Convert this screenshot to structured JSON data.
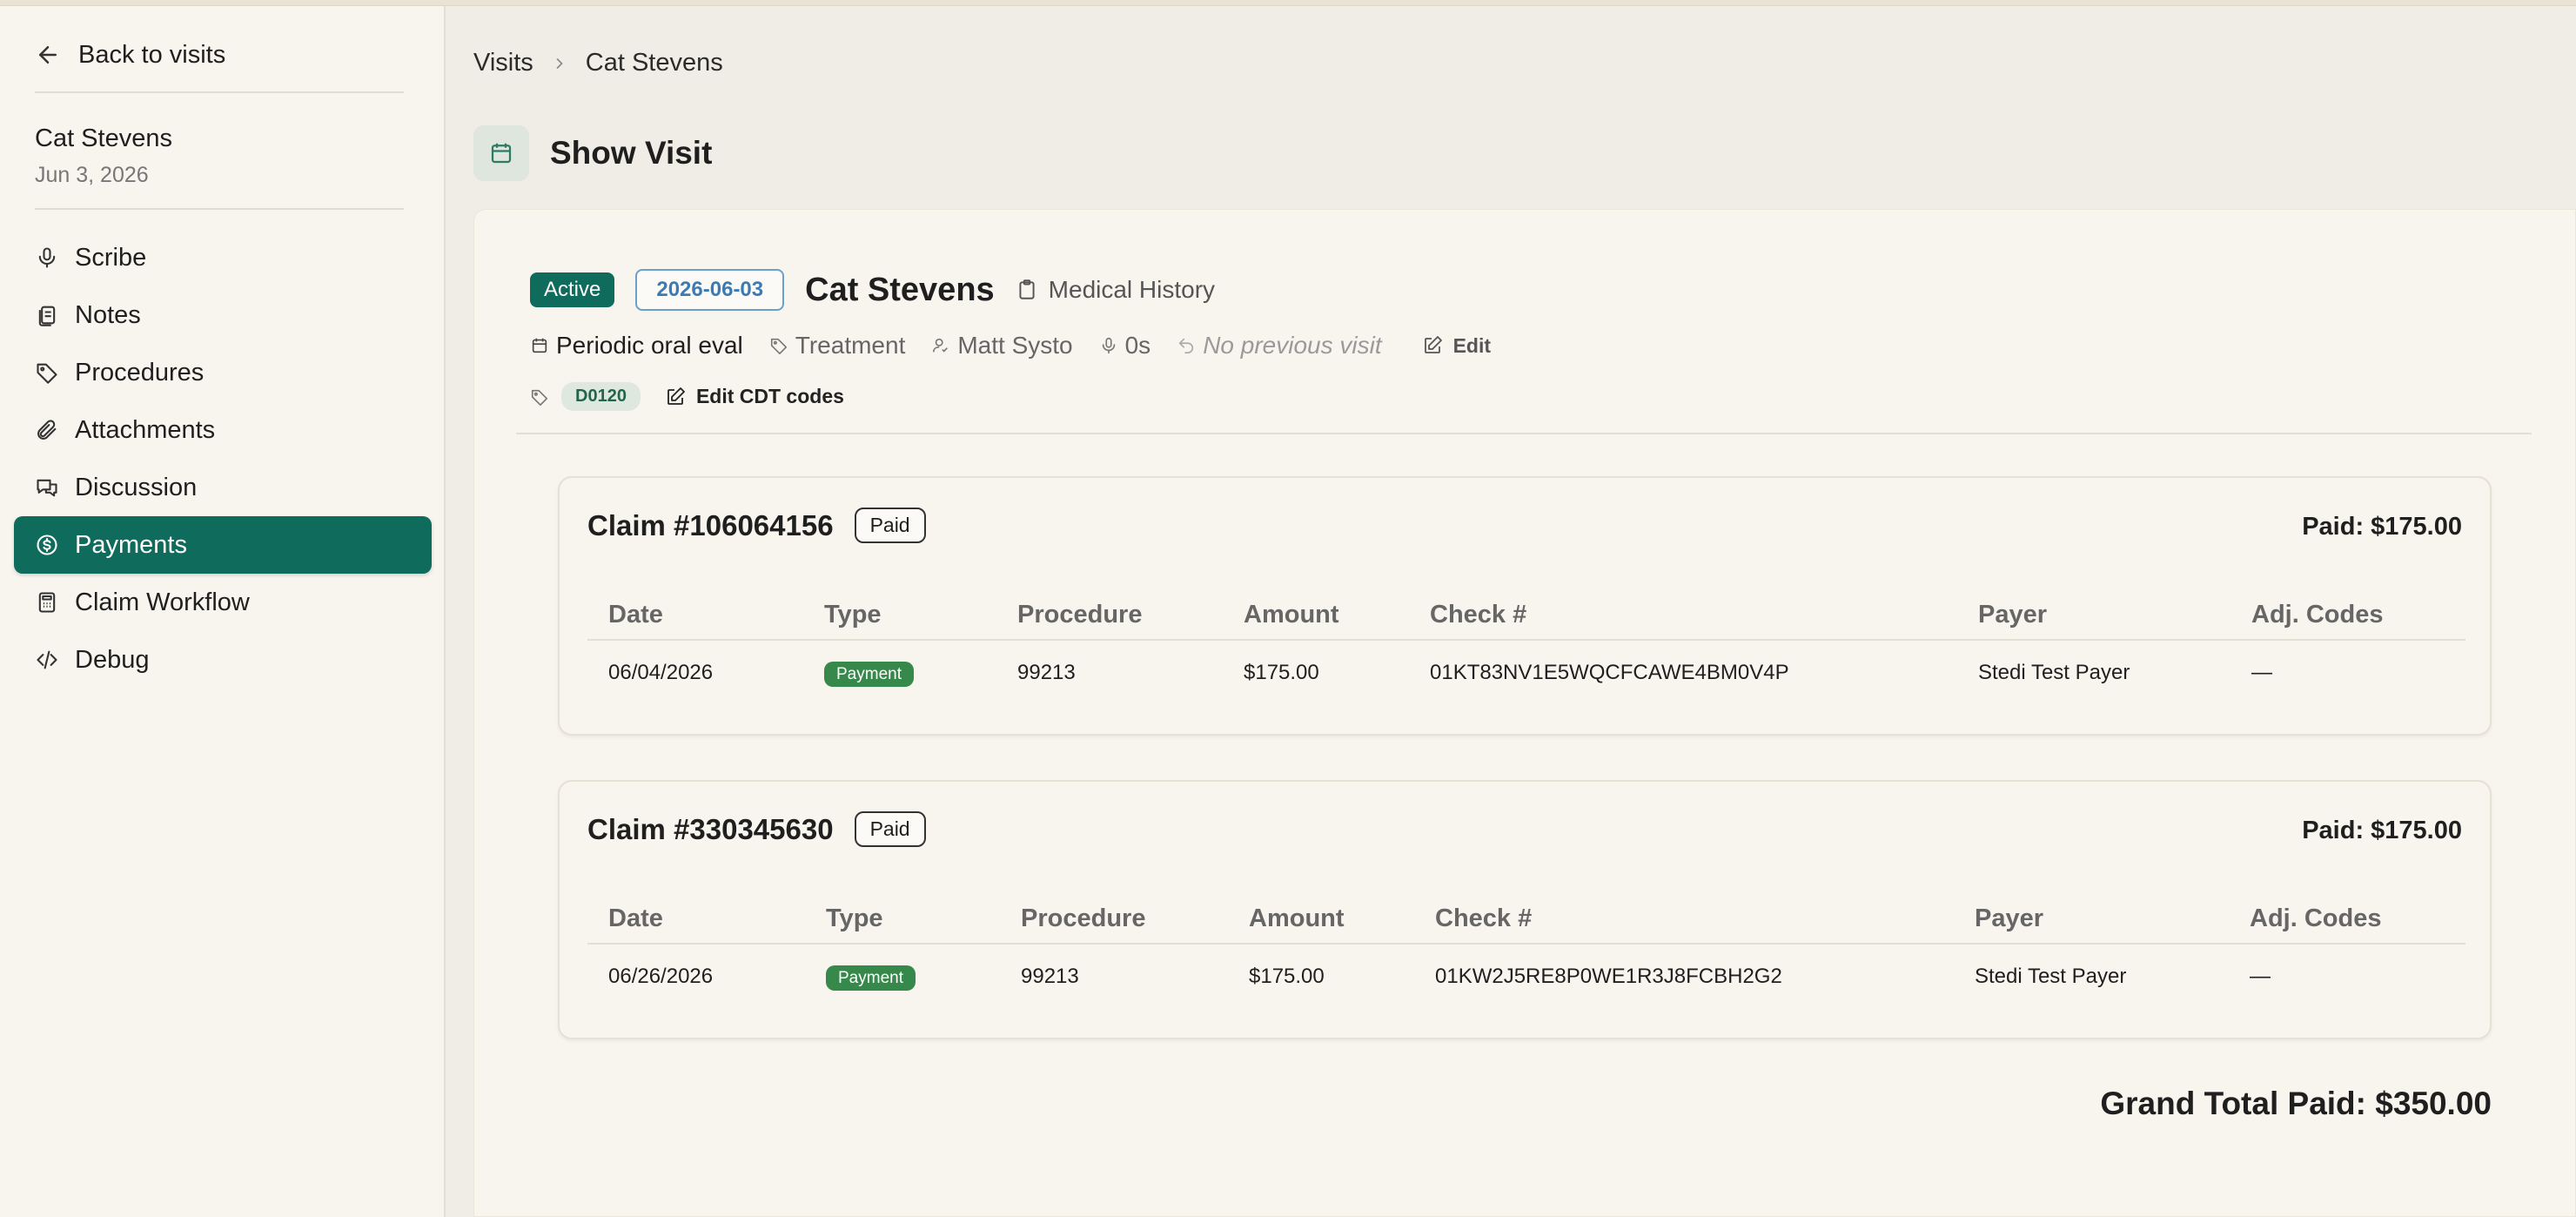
{
  "sidebar": {
    "back_label": "Back to visits",
    "patient_name": "Cat Stevens",
    "visit_date": "Jun 3, 2026",
    "items": [
      {
        "label": "Scribe",
        "icon": "microphone-icon"
      },
      {
        "label": "Notes",
        "icon": "notes-icon"
      },
      {
        "label": "Procedures",
        "icon": "tag-icon"
      },
      {
        "label": "Attachments",
        "icon": "paperclip-icon"
      },
      {
        "label": "Discussion",
        "icon": "chat-icon"
      },
      {
        "label": "Payments",
        "icon": "dollar-circle-icon",
        "active": true
      },
      {
        "label": "Claim Workflow",
        "icon": "calculator-icon"
      },
      {
        "label": "Debug",
        "icon": "code-icon"
      }
    ]
  },
  "breadcrumb": {
    "root": "Visits",
    "current": "Cat Stevens"
  },
  "page_title": "Show Visit",
  "visit": {
    "status": "Active",
    "date": "2026-06-03",
    "patient": "Cat Stevens",
    "medical_history": "Medical History",
    "procedure_name": "Periodic oral eval",
    "category": "Treatment",
    "provider": "Matt Systo",
    "duration": "0s",
    "previous_visit": "No previous visit",
    "edit_label": "Edit",
    "cdt_code": "D0120",
    "edit_cdt_label": "Edit CDT codes"
  },
  "colors": {
    "accent": "#0f6b5c",
    "payment_badge": "#36894a",
    "date_badge": "#3b7bb5"
  },
  "table_headers": [
    "Date",
    "Type",
    "Procedure",
    "Amount",
    "Check #",
    "Payer",
    "Adj. Codes"
  ],
  "claims": [
    {
      "title": "Claim #106064156",
      "status": "Paid",
      "paid": "Paid: $175.00",
      "row": {
        "date": "06/04/2026",
        "type": "Payment",
        "procedure": "99213",
        "amount": "$175.00",
        "check": "01KT83NV1E5WQCFCAWE4BM0V4P",
        "payer": "Stedi Test Payer",
        "adj": "—"
      }
    },
    {
      "title": "Claim #330345630",
      "status": "Paid",
      "paid": "Paid: $175.00",
      "row": {
        "date": "06/26/2026",
        "type": "Payment",
        "procedure": "99213",
        "amount": "$175.00",
        "check": "01KW2J5RE8P0WE1R3J8FCBH2G2",
        "payer": "Stedi Test Payer",
        "adj": "—"
      }
    }
  ],
  "grand_total": "Grand Total Paid: $350.00"
}
